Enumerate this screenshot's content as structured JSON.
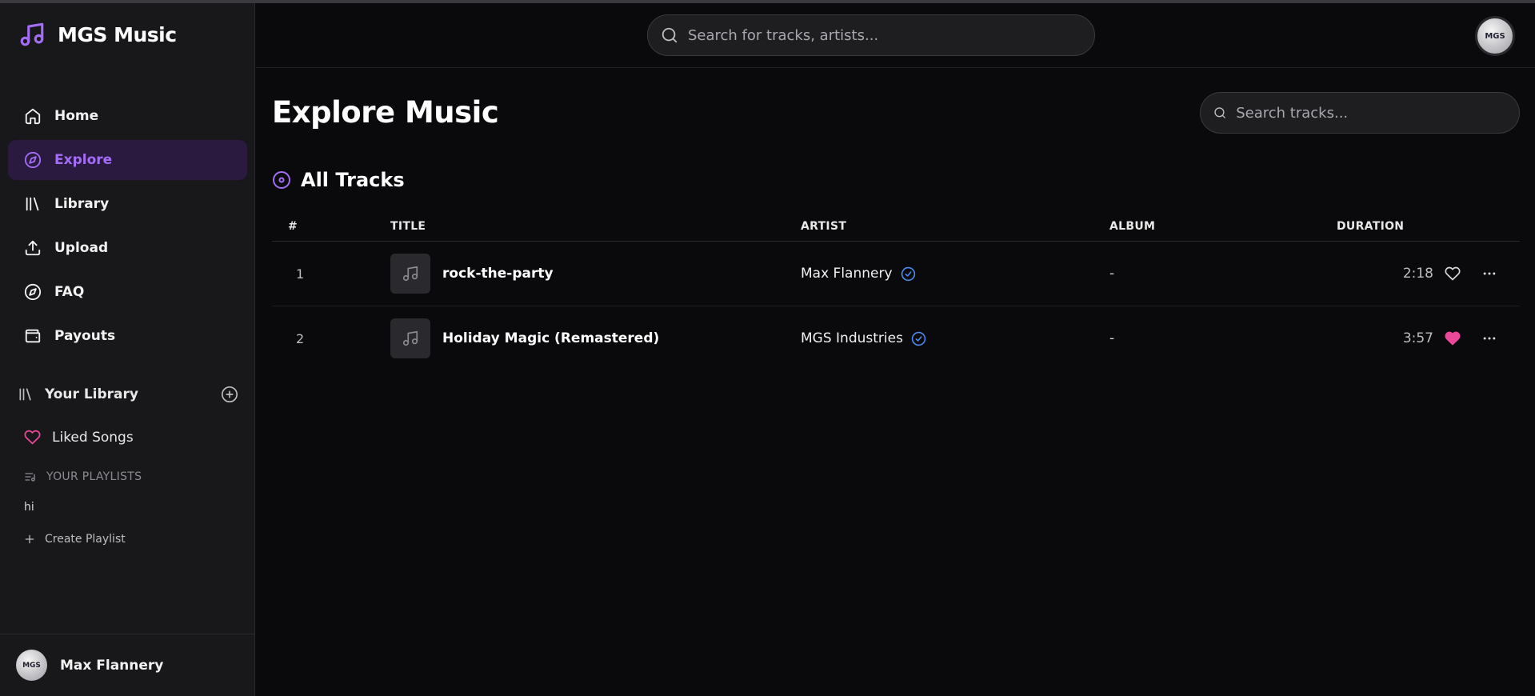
{
  "app": {
    "name": "MGS Music"
  },
  "nav": [
    {
      "label": "Home",
      "icon": "home-icon",
      "active": false
    },
    {
      "label": "Explore",
      "icon": "compass-icon",
      "active": true
    },
    {
      "label": "Library",
      "icon": "library-icon",
      "active": false
    },
    {
      "label": "Upload",
      "icon": "upload-icon",
      "active": false
    },
    {
      "label": "FAQ",
      "icon": "compass-icon",
      "active": false
    },
    {
      "label": "Payouts",
      "icon": "wallet-icon",
      "active": false
    }
  ],
  "library": {
    "title": "Your Library",
    "liked_songs": "Liked Songs",
    "playlists_header": "YOUR PLAYLISTS",
    "playlists": [
      "hi"
    ],
    "create_playlist": "Create Playlist"
  },
  "user": {
    "name": "Max Flannery",
    "avatar_text": "MGS"
  },
  "header": {
    "search_placeholder": "Search for tracks, artists..."
  },
  "page": {
    "title": "Explore Music",
    "search_placeholder": "Search tracks...",
    "section_title": "All Tracks"
  },
  "table": {
    "columns": {
      "num": "#",
      "title": "TITLE",
      "artist": "ARTIST",
      "album": "ALBUM",
      "duration": "DURATION"
    },
    "rows": [
      {
        "num": "1",
        "title": "rock-the-party",
        "artist": "Max Flannery",
        "album": "-",
        "duration": "2:18",
        "liked": false
      },
      {
        "num": "2",
        "title": "Holiday Magic (Remastered)",
        "artist": "MGS Industries",
        "album": "-",
        "duration": "3:57",
        "liked": true
      }
    ]
  },
  "colors": {
    "accent": "#a46df5",
    "liked": "#ec4899",
    "verified": "#4a8cf0",
    "background": "#0a0a0c",
    "sidebar": "#18181b"
  }
}
